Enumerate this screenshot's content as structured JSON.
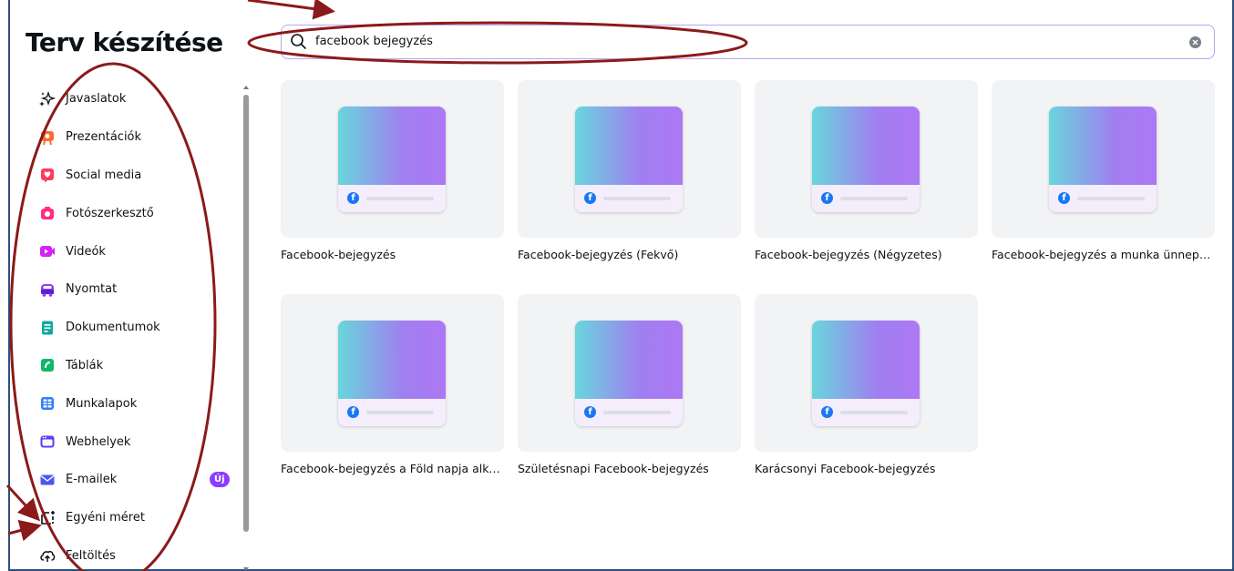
{
  "page": {
    "title": "Terv készítése"
  },
  "search": {
    "query": "facebook bejegyzés"
  },
  "sidebar": {
    "items": [
      {
        "label": "Javaslatok",
        "icon": "sparkle-icon",
        "color": "#0d1216"
      },
      {
        "label": "Prezentációk",
        "icon": "presentation-icon",
        "color": "#ff6b2c"
      },
      {
        "label": "Social media",
        "icon": "heart-icon",
        "color": "#ff3b5c"
      },
      {
        "label": "Fotószerkesztő",
        "icon": "camera-icon",
        "color": "#ff2e7e"
      },
      {
        "label": "Videók",
        "icon": "video-icon",
        "color": "#d324f5"
      },
      {
        "label": "Nyomtat",
        "icon": "print-bus-icon",
        "color": "#8b3dff"
      },
      {
        "label": "Dokumentumok",
        "icon": "document-icon",
        "color": "#13a89e"
      },
      {
        "label": "Táblák",
        "icon": "whiteboard-icon",
        "color": "#12b76a"
      },
      {
        "label": "Munkalapok",
        "icon": "sheet-icon",
        "color": "#2d7ff9"
      },
      {
        "label": "Webhelyek",
        "icon": "website-icon",
        "color": "#5a3df5"
      },
      {
        "label": "E-mailek",
        "icon": "mail-icon",
        "color": "#4957f5",
        "badge": "Új"
      },
      {
        "label": "Egyéni méret",
        "icon": "custom-size-icon",
        "color": "#0d1216"
      },
      {
        "label": "Feltöltés",
        "icon": "upload-cloud-icon",
        "color": "#0d1216"
      }
    ]
  },
  "results": {
    "cards": [
      {
        "name": "Facebook-bejegyzés"
      },
      {
        "name": "Facebook-bejegyzés (Fekvő)"
      },
      {
        "name": "Facebook-bejegyzés (Négyzetes)"
      },
      {
        "name": "Facebook-bejegyzés a munka ünnepe..."
      },
      {
        "name": "Facebook-bejegyzés a Föld napja alka..."
      },
      {
        "name": "Születésnapi Facebook-bejegyzés"
      },
      {
        "name": "Karácsonyi Facebook-bejegyzés"
      }
    ],
    "fb_glyph": "f"
  },
  "colors": {
    "annotation": "#8b1a1a",
    "accent": "#8b3dff",
    "frame": "#2c4f7c"
  }
}
